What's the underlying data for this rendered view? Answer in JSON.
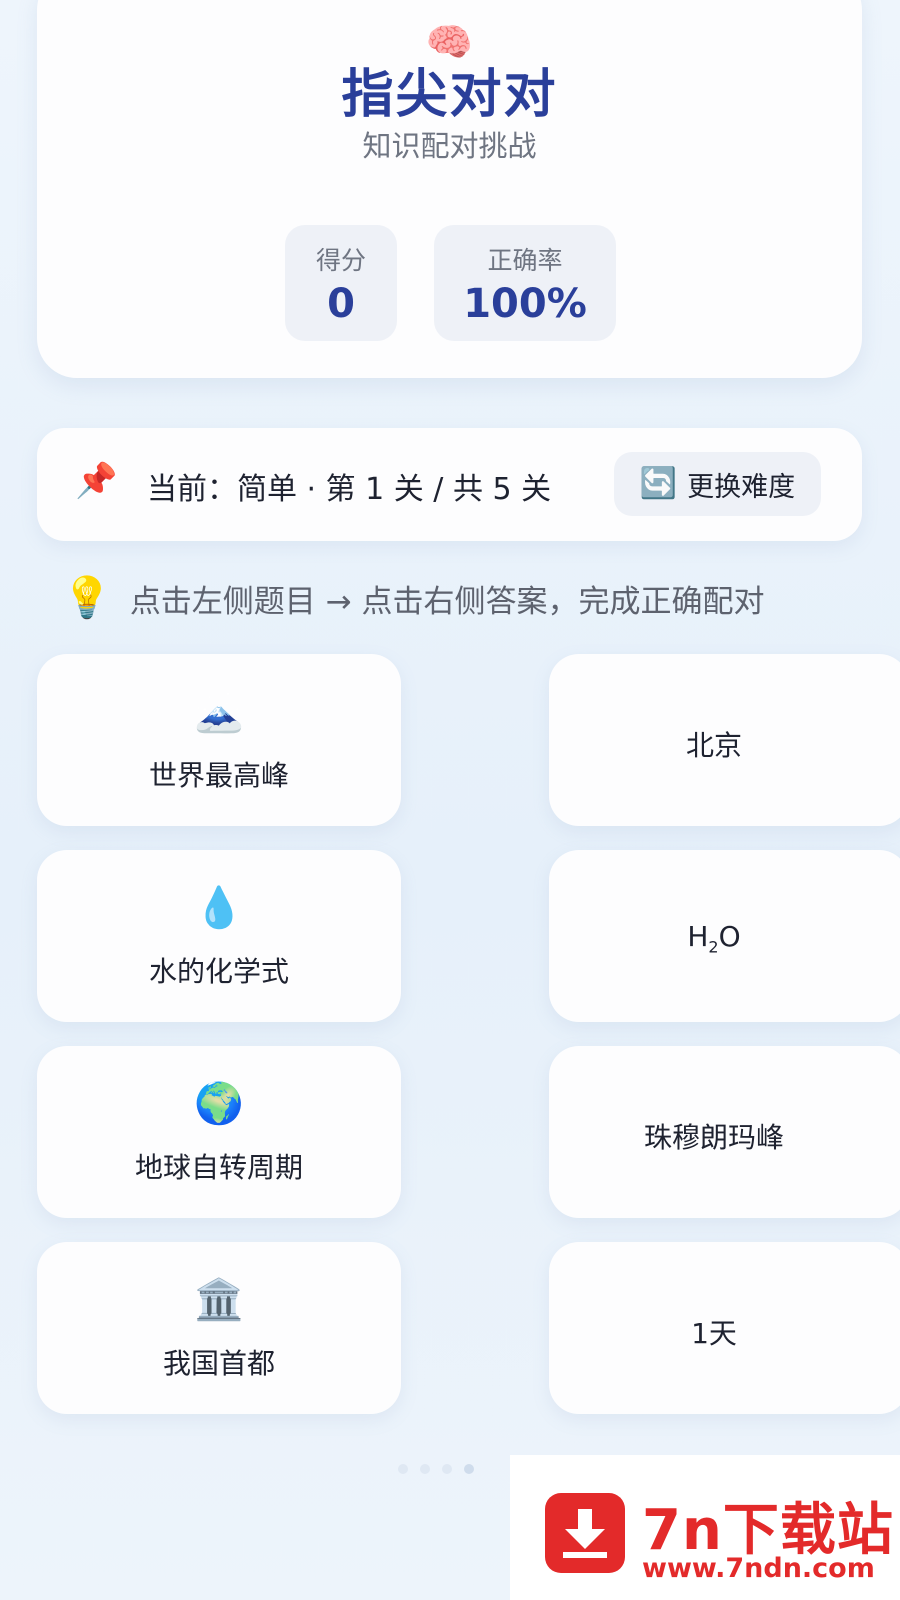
{
  "header": {
    "icon": "brain-icon",
    "emoji": "🧠",
    "title": "指尖对对",
    "subtitle": "知识配对挑战",
    "score_label": "得分",
    "score_value": "0",
    "accuracy_label": "正确率",
    "accuracy_value": "100%"
  },
  "level": {
    "pin_emoji": "📌",
    "text": "当前：简单 · 第 1 关 / 共 5 关",
    "change_button_icon": "🔄",
    "change_button_label": "更换难度"
  },
  "hint": {
    "emoji": "💡",
    "text": "点击左侧题目 → 点击右侧答案，完成正确配对"
  },
  "questions": [
    {
      "emoji": "🗻",
      "icon": "mountain-icon",
      "text": "世界最高峰"
    },
    {
      "emoji": "💧",
      "icon": "water-drop-icon",
      "text": "水的化学式"
    },
    {
      "emoji": "🌍",
      "icon": "globe-icon",
      "text": "地球自转周期"
    },
    {
      "emoji": "🏛️",
      "icon": "classical-building-icon",
      "text": "我国首都"
    }
  ],
  "answers": [
    {
      "text": "北京"
    },
    {
      "formula_base": "H",
      "formula_sub": "2",
      "formula_tail": "O"
    },
    {
      "text": "珠穆朗玛峰"
    },
    {
      "text": "1天"
    }
  ],
  "watermark": {
    "name": "7n下载站",
    "url": "www.7ndn.com",
    "color": "#e32a2a"
  },
  "colors": {
    "accent": "#2a3f9a",
    "card_bg": "#fdfdfe",
    "stat_bg": "#eef1f7"
  }
}
